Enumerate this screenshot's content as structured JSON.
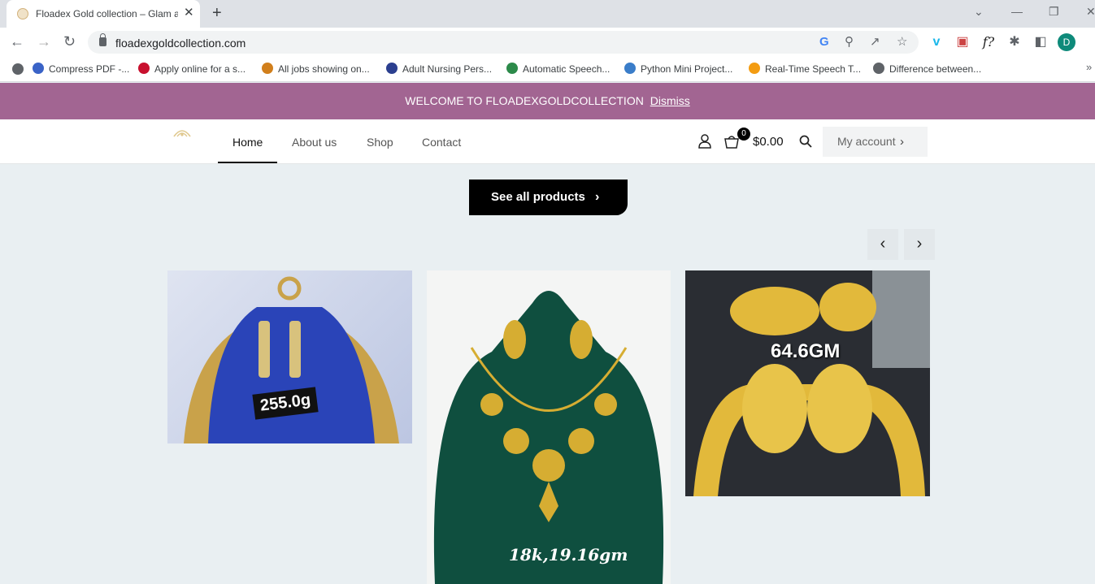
{
  "browser": {
    "tab_title": "Floadex Gold collection – Glam and",
    "tab_close": "✕",
    "new_tab": "+",
    "url": "floadexgoldcollection.com",
    "profile_initial": "D",
    "bookmarks": [
      {
        "label": "Compress PDF -...",
        "color": "#3a63c7"
      },
      {
        "label": "Apply online for a s...",
        "color": "#c8102e"
      },
      {
        "label": "All jobs showing on...",
        "color": "#d17f1c"
      },
      {
        "label": "Adult Nursing Pers...",
        "color": "#2b3f8f"
      },
      {
        "label": "Automatic Speech...",
        "color": "#2c8a4a"
      },
      {
        "label": "Python Mini Project...",
        "color": "#3a7dc9"
      },
      {
        "label": "Real-Time Speech T...",
        "color": "#f39c12"
      },
      {
        "label": "Difference between...",
        "color": "#5f6368"
      }
    ],
    "more_bookmarks": "»"
  },
  "site": {
    "notice_text": "WELCOME TO FLOADEXGOLDCOLLECTION",
    "notice_dismiss": "Dismiss",
    "menu": [
      "Home",
      "About us",
      "Shop",
      "Contact"
    ],
    "cart_count": "0",
    "cart_total": "$0.00",
    "my_account": "My account",
    "see_all": "See all products",
    "products": [
      {
        "weight": "255.0g"
      },
      {
        "weight": "18k,19.16gm"
      },
      {
        "weight": "64.6GM"
      }
    ]
  },
  "colors": {
    "notice_bg": "#a26592",
    "page_bg": "#e9eff2",
    "gold": "#d6ad32"
  }
}
